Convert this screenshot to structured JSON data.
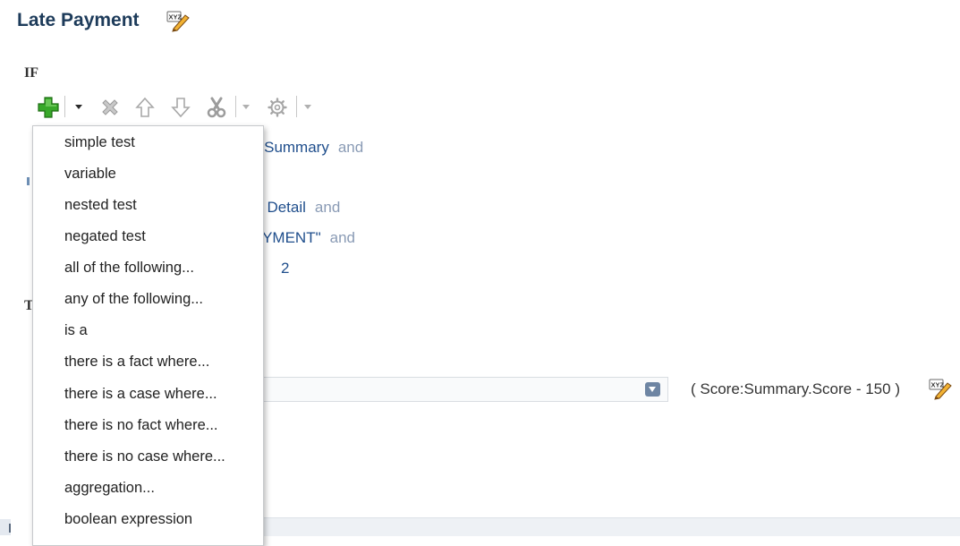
{
  "rule": {
    "title": "Late Payment"
  },
  "sections": {
    "if_label": "IF",
    "then_label": "T"
  },
  "conditions": {
    "line1": {
      "text": "rt Summary",
      "keyword": "and"
    },
    "line2": {
      "text": "t Detail",
      "keyword": "and"
    },
    "line3": {
      "text": "AYMENT\"",
      "keyword": "and"
    },
    "line4": {
      "text": "2"
    }
  },
  "action": {
    "select_value": "",
    "expression": "( Score:Summary.Score - 150 )"
  },
  "toolbar": {
    "icons": [
      "add-icon",
      "dropdown-arrow-icon",
      "delete-icon",
      "move-up-icon",
      "move-down-icon",
      "cut-icon",
      "dropdown-arrow-icon",
      "gear-icon",
      "dropdown-arrow-icon"
    ]
  },
  "menu": {
    "items": [
      "simple test",
      "variable",
      "nested test",
      "negated test",
      "all of the following...",
      "any of the following...",
      "is a",
      "there is a fact where...",
      "there is a case where...",
      "there is no fact where...",
      "there is no case where...",
      "aggregation...",
      "boolean expression"
    ]
  },
  "colors": {
    "title": "#1d3b5a",
    "link": "#1f4e8c",
    "keyword": "#8a9bb5",
    "add_green": "#2e9e1f"
  }
}
